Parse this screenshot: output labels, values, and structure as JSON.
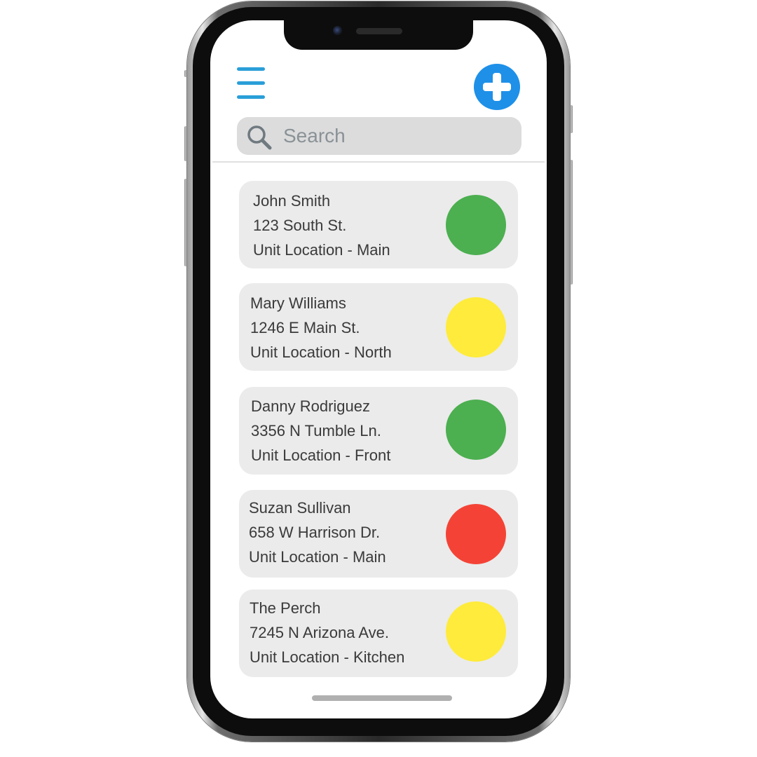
{
  "header": {
    "menu_icon": "hamburger-menu-icon",
    "add_icon": "plus-icon",
    "add_color": "#1e90e8",
    "menu_color": "#2a9fd8"
  },
  "search": {
    "placeholder": "Search",
    "value": "",
    "icon": "search-icon"
  },
  "status_colors": {
    "green": "#4caf50",
    "yellow": "#ffeb3b",
    "red": "#f44336"
  },
  "units": [
    {
      "name": "John Smith",
      "address": "123 South St.",
      "location": "Unit Location - Main",
      "status": "green"
    },
    {
      "name": "Mary Williams",
      "address": "1246 E Main St.",
      "location": "Unit Location - North",
      "status": "yellow"
    },
    {
      "name": "Danny Rodriguez",
      "address": "3356 N Tumble Ln.",
      "location": "Unit Location - Front",
      "status": "green"
    },
    {
      "name": "Suzan Sullivan",
      "address": "658 W Harrison Dr.",
      "location": "Unit Location - Main",
      "status": "red"
    },
    {
      "name": "The Perch",
      "address": "7245 N Arizona Ave.",
      "location": "Unit Location - Kitchen",
      "status": "yellow"
    }
  ]
}
